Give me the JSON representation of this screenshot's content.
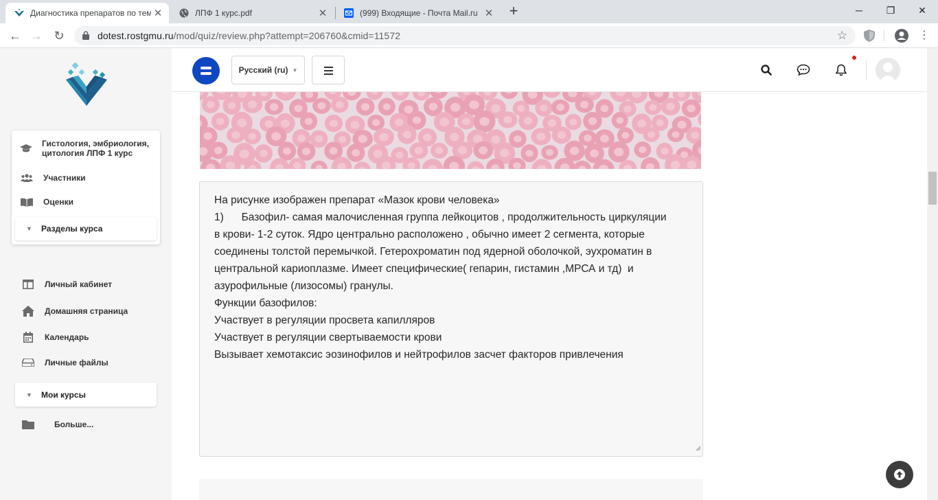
{
  "browser": {
    "tabs": [
      {
        "title": "Диагностика препаратов по тем",
        "active": true
      },
      {
        "title": "ЛПФ 1 курс.pdf",
        "active": false
      },
      {
        "title": "(999) Входящие - Почта Mail.ru",
        "active": false
      }
    ],
    "address": {
      "host": "dotest.rostgmu.ru",
      "path": "/mod/quiz/review.php?attempt=206760&cmid=11572"
    }
  },
  "header": {
    "language": "Русский (ru)"
  },
  "sidebar": {
    "course_nav": [
      {
        "label": "Гистология, эмбриология, цитология ЛПФ 1 курс",
        "icon": "graduation-cap-icon"
      },
      {
        "label": "Участники",
        "icon": "users-icon"
      },
      {
        "label": "Оценки",
        "icon": "book-icon"
      }
    ],
    "sections_label": "Разделы курса",
    "nav": [
      {
        "label": "Личный кабинет",
        "icon": "dashboard-icon"
      },
      {
        "label": "Домашняя страница",
        "icon": "home-icon"
      },
      {
        "label": "Календарь",
        "icon": "calendar-icon"
      },
      {
        "label": "Личные файлы",
        "icon": "hdd-icon"
      }
    ],
    "my_courses_label": "Мои курсы",
    "more_label": "Больше..."
  },
  "answer": {
    "lines": [
      "На рисунке изображен препарат «Мазок крови человека»",
      "1)      Базофил- самая малочисленная группа лейкоцитов , продолжительность циркуляции",
      "в крови- 1-2 суток. Ядро центрально расположено , обычно имеет 2 сегмента, которые",
      "соединены толстой перемычкой. Гетерохроматин под ядерной оболочкой, эухроматин в",
      "центральной кариоплазме. Имеет специфические( гепарин, гистамин ,МРСА и тд)  и",
      "азурофильные (лизосомы) гранулы.",
      "Функции базофилов:",
      "Участвует в регуляции просвета капилляров",
      "Участвует в регуляции свертываемости крови",
      "Вызывает хемотаксис эозинофилов и нейтрофилов засчет факторов привлечения"
    ]
  },
  "colors": {
    "brand": "#0f47c3",
    "tab_bg": "#dee1e6",
    "sidebar_bg": "#f5f5f5",
    "answer_bg": "#f7f7f7"
  }
}
